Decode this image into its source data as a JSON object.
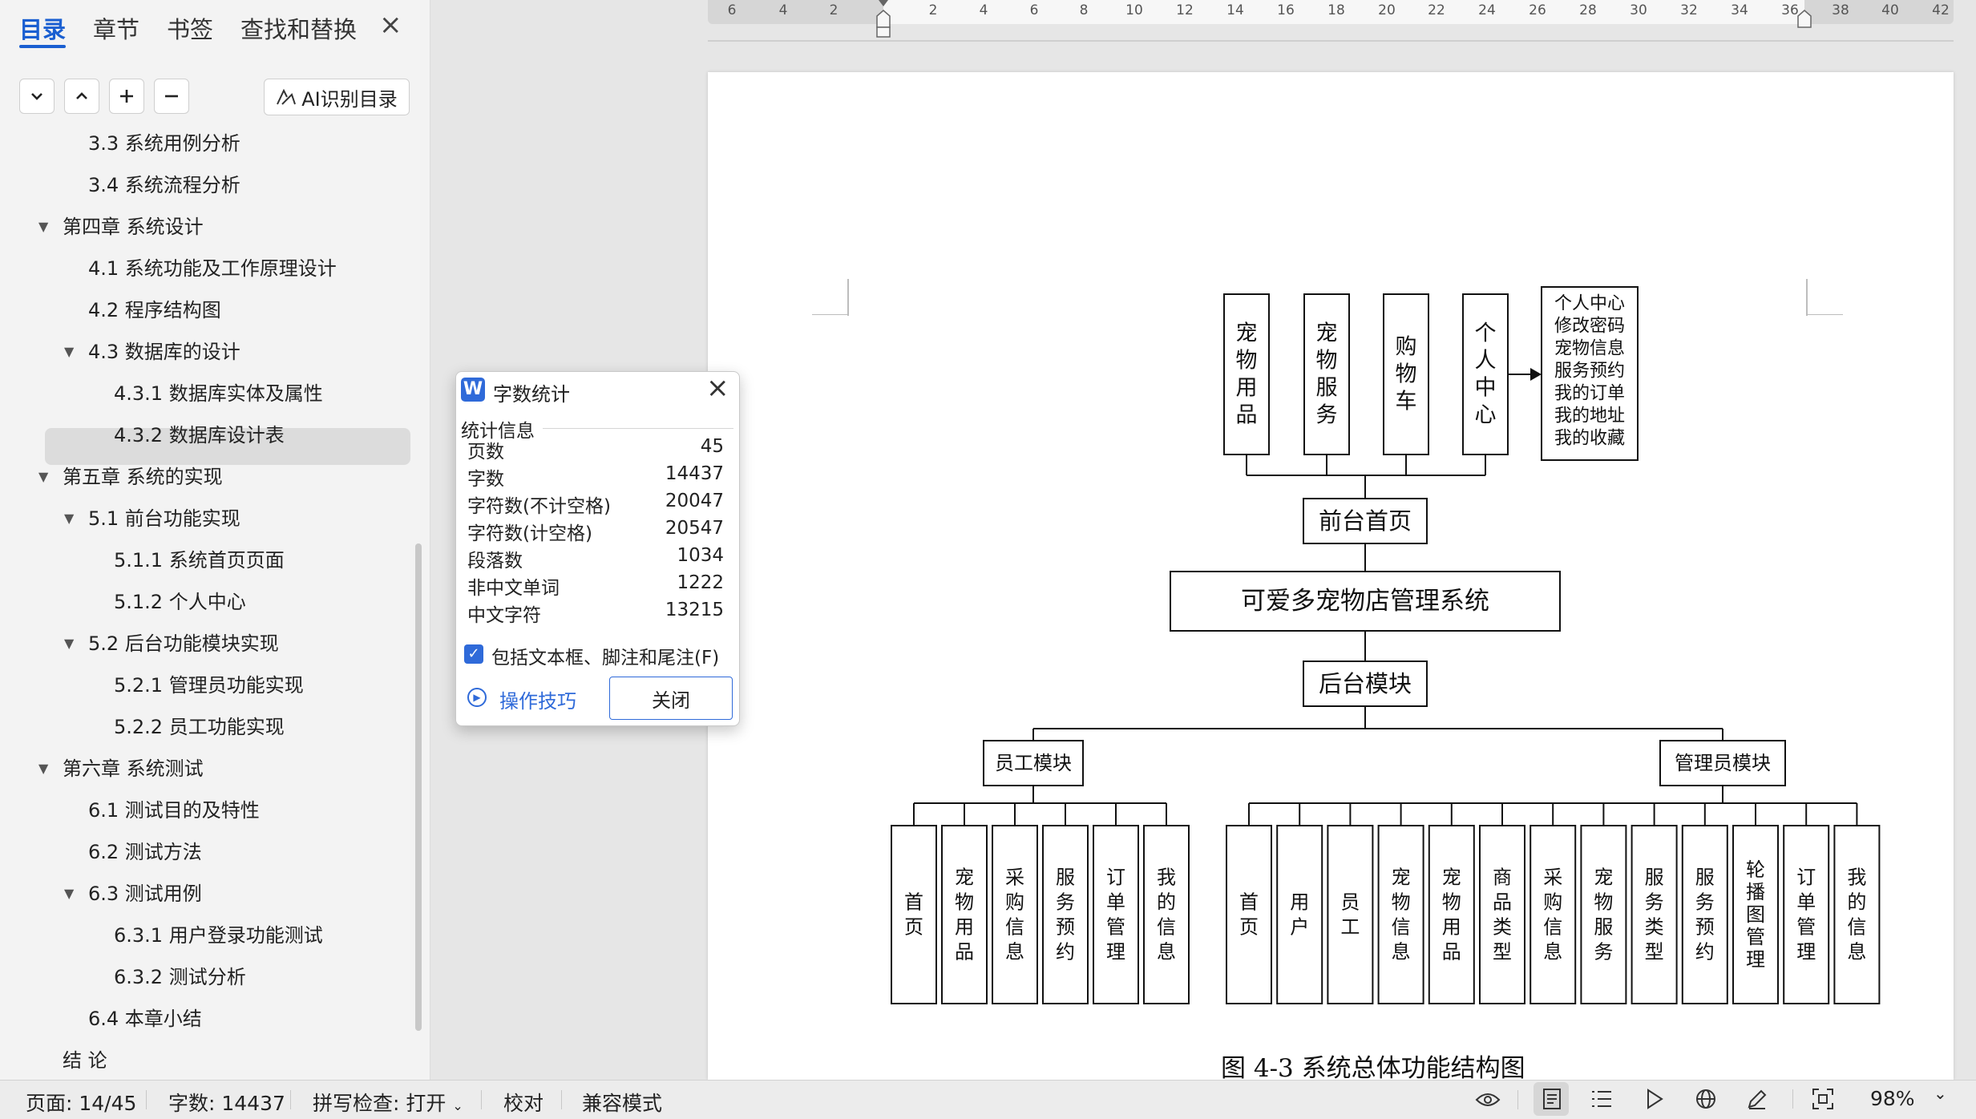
{
  "nav": {
    "tabs": [
      "目录",
      "章节",
      "书签",
      "查找和替换"
    ],
    "ai_button": "AI识别目录",
    "toc": [
      {
        "label": "3.3 系统用例分析",
        "level": 2
      },
      {
        "label": "3.4 系统流程分析",
        "level": 2
      },
      {
        "label": "第四章  系统设计",
        "level": 1
      },
      {
        "label": "4.1 系统功能及工作原理设计",
        "level": 2
      },
      {
        "label": "4.2 程序结构图",
        "level": 2
      },
      {
        "label": "4.3 数据库的设计",
        "level": 2
      },
      {
        "label": "4.3.1 数据库实体及属性",
        "level": 3
      },
      {
        "label": "4.3.2 数据库设计表",
        "level": 3
      },
      {
        "label": "第五章  系统的实现",
        "level": 1
      },
      {
        "label": "5.1 前台功能实现",
        "level": 2
      },
      {
        "label": "5.1.1 系统首页页面",
        "level": 3
      },
      {
        "label": "5.1.2 个人中心",
        "level": 3
      },
      {
        "label": "5.2 后台功能模块实现",
        "level": 2
      },
      {
        "label": "5.2.1 管理员功能实现",
        "level": 3
      },
      {
        "label": "5.2.2 员工功能实现",
        "level": 3
      },
      {
        "label": "第六章  系统测试",
        "level": 1
      },
      {
        "label": "6.1 测试目的及特性",
        "level": 2
      },
      {
        "label": "6.2 测试方法",
        "level": 2
      },
      {
        "label": "6.3 测试用例",
        "level": 2
      },
      {
        "label": "6.3.1 用户登录功能测试",
        "level": 3
      },
      {
        "label": "6.3.2 测试分析",
        "level": 3
      },
      {
        "label": "6.4 本章小结",
        "level": 2
      },
      {
        "label": "结    论",
        "level": 1
      }
    ]
  },
  "ruler": {
    "labels": [
      "6",
      "4",
      "2",
      "2",
      "4",
      "6",
      "8",
      "10",
      "12",
      "14",
      "16",
      "18",
      "20",
      "22",
      "24",
      "26",
      "28",
      "30",
      "32",
      "34",
      "36",
      "38",
      "40",
      "42"
    ]
  },
  "diagram": {
    "front_modules": [
      "宠物用品",
      "宠物服务",
      "购物车",
      "个人中心"
    ],
    "personal_center_items": [
      "个人中心",
      "修改密码",
      "宠物信息",
      "服务预约",
      "我的订单",
      "我的地址",
      "我的收藏"
    ],
    "front_home": "前台首页",
    "system_name": "可爱多宠物店管理系统",
    "backend": "后台模块",
    "staff_module": "员工模块",
    "admin_module": "管理员模块",
    "staff_items": [
      "首页",
      "宠物用品",
      "采购信息",
      "服务预约",
      "订单管理",
      "我的信息"
    ],
    "admin_items": [
      "首页",
      "用户",
      "员工",
      "宠物信息",
      "宠物用品",
      "商品类型",
      "采购信息",
      "宠物服务",
      "服务类型",
      "服务预约",
      "轮播图管理",
      "订单管理",
      "我的信息"
    ],
    "caption": "图 4-3  系统总体功能结构图"
  },
  "dialog": {
    "title": "字数统计",
    "section": "统计信息",
    "stats": [
      {
        "label": "页数",
        "value": "45"
      },
      {
        "label": "字数",
        "value": "14437"
      },
      {
        "label": "字符数(不计空格)",
        "value": "20047"
      },
      {
        "label": "字符数(计空格)",
        "value": "20547"
      },
      {
        "label": "段落数",
        "value": "1034"
      },
      {
        "label": "非中文单词",
        "value": "1222"
      },
      {
        "label": "中文字符",
        "value": "13215"
      }
    ],
    "include_label": "包括文本框、脚注和尾注(F)",
    "include_checked": true,
    "tips": "操作技巧",
    "close": "关闭"
  },
  "status": {
    "page": "页面: 14/45",
    "words": "字数: 14437",
    "spell": "拼写检查: 打开",
    "proof": "校对",
    "compat": "兼容模式",
    "zoom": "98%"
  }
}
